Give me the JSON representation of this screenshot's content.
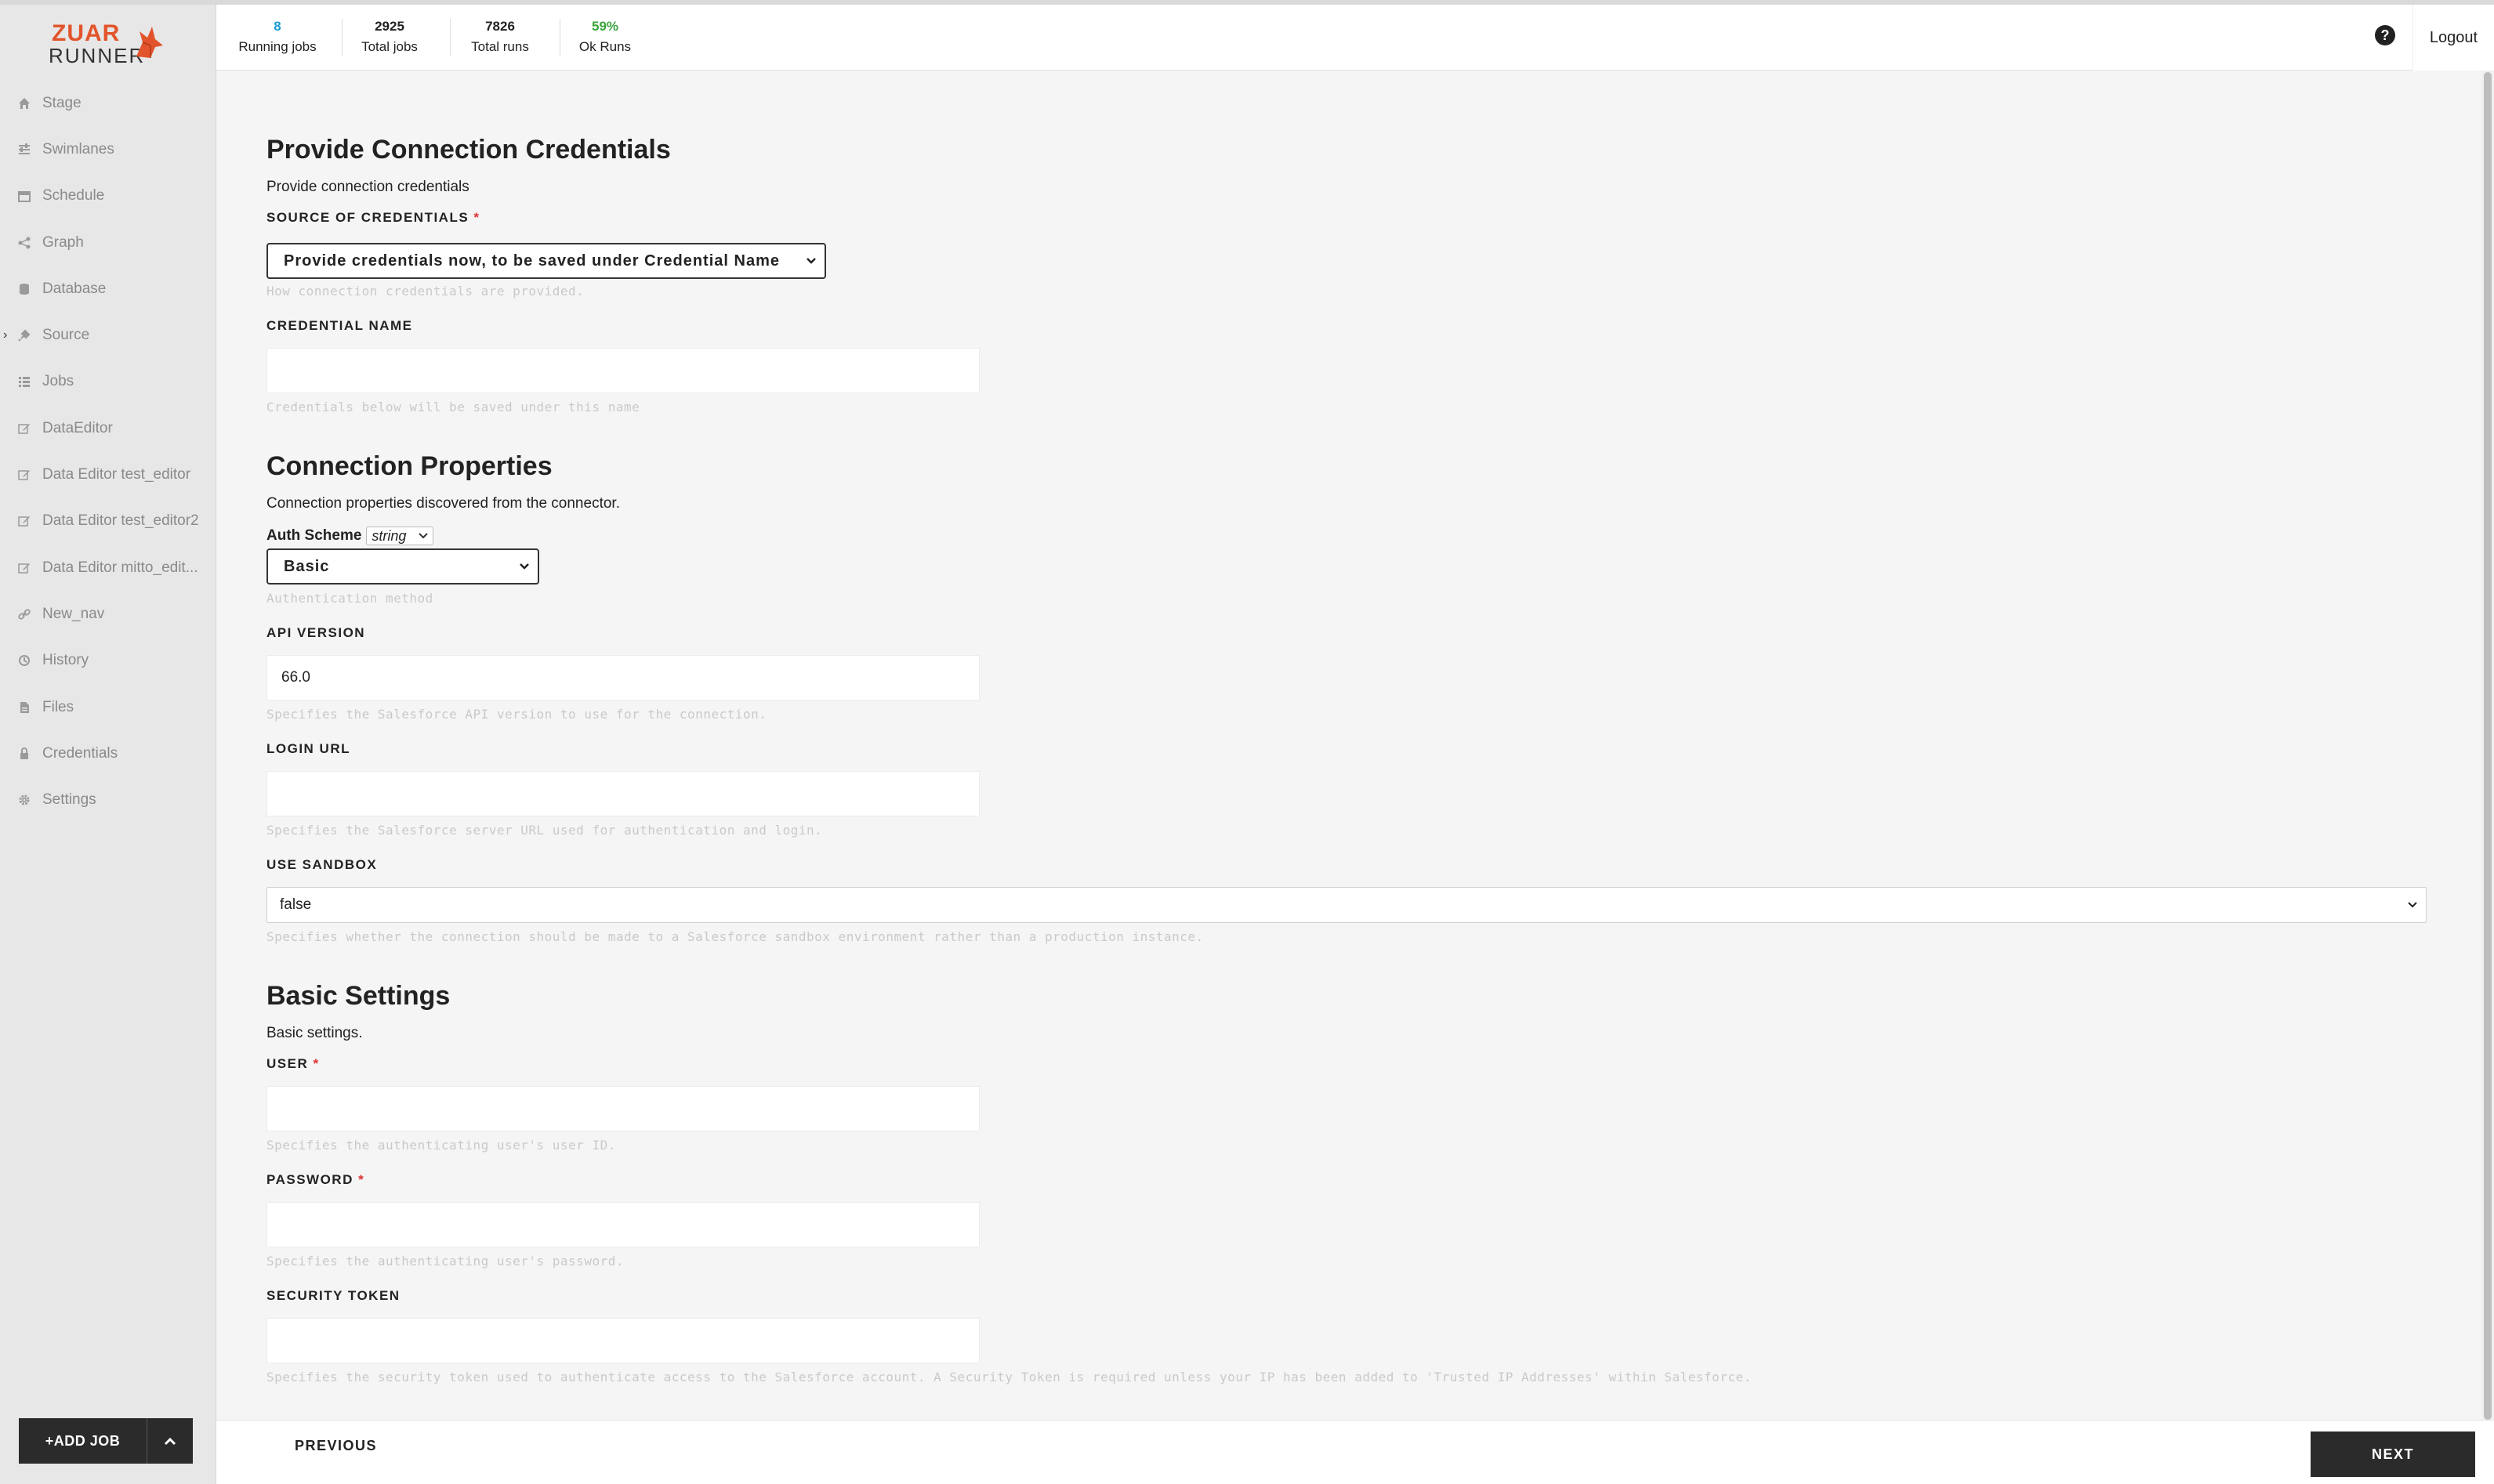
{
  "app": {
    "logo_top": "ZUAR",
    "logo_bottom": "RUNNER"
  },
  "header": {
    "stats": [
      {
        "value": "8",
        "label": "Running jobs",
        "color": "#1a9ad6"
      },
      {
        "value": "2925",
        "label": "Total jobs",
        "color": "#222222"
      },
      {
        "value": "7826",
        "label": "Total runs",
        "color": "#222222"
      },
      {
        "value": "59%",
        "label": "Ok Runs",
        "color": "#3aa53a"
      }
    ],
    "help_glyph": "?",
    "logout": "Logout"
  },
  "sidebar": {
    "items": [
      {
        "label": "Stage",
        "icon": "home-icon"
      },
      {
        "label": "Swimlanes",
        "icon": "sliders-icon"
      },
      {
        "label": "Schedule",
        "icon": "calendar-icon"
      },
      {
        "label": "Graph",
        "icon": "share-icon"
      },
      {
        "label": "Database",
        "icon": "database-icon"
      },
      {
        "label": "Source",
        "icon": "plug-icon",
        "expanded_caret": "›"
      },
      {
        "label": "Jobs",
        "icon": "list-icon"
      },
      {
        "label": "DataEditor",
        "icon": "edit-icon"
      },
      {
        "label": "Data Editor test_editor",
        "icon": "edit-icon"
      },
      {
        "label": "Data Editor test_editor2",
        "icon": "edit-icon"
      },
      {
        "label": "Data Editor mitto_edit...",
        "icon": "edit-icon"
      },
      {
        "label": "New_nav",
        "icon": "link-icon"
      },
      {
        "label": "History",
        "icon": "history-icon"
      },
      {
        "label": "Files",
        "icon": "file-icon"
      },
      {
        "label": "Credentials",
        "icon": "lock-icon"
      },
      {
        "label": "Settings",
        "icon": "gear-icon"
      }
    ],
    "add_job": "+ADD JOB"
  },
  "form": {
    "credentials": {
      "title": "Provide Connection Credentials",
      "description": "Provide connection credentials",
      "source_label": "SOURCE OF CREDENTIALS",
      "source_value": "Provide credentials now, to be saved under Credential Name",
      "source_hint": "How connection credentials are provided.",
      "name_label": "CREDENTIAL NAME",
      "name_value": "",
      "name_hint": "Credentials below will be saved under this name"
    },
    "connection": {
      "title": "Connection Properties",
      "description": "Connection properties discovered from the connector.",
      "auth_label": "Auth Scheme",
      "auth_type": "string",
      "auth_value": "Basic",
      "auth_hint": "Authentication method",
      "api_label": "API VERSION",
      "api_value": "66.0",
      "api_hint": "Specifies the Salesforce API version to use for the connection.",
      "login_label": "LOGIN URL",
      "login_value": "",
      "login_hint": "Specifies the Salesforce server URL used for authentication and login.",
      "sandbox_label": "USE SANDBOX",
      "sandbox_value": "false",
      "sandbox_hint": "Specifies whether the connection should be made to a Salesforce sandbox environment rather than a production instance."
    },
    "basic": {
      "title": "Basic Settings",
      "description": "Basic settings.",
      "user_label": "USER",
      "user_value": "",
      "user_hint": "Specifies the authenticating user's user ID.",
      "password_label": "PASSWORD",
      "password_value": "",
      "password_hint": "Specifies the authenticating user's password.",
      "token_label": "SECURITY TOKEN",
      "token_value": "",
      "token_hint": "Specifies the security token used to authenticate access to the Salesforce account. A Security Token is required unless your IP has been added to 'Trusted IP Addresses' within Salesforce."
    },
    "required_mark": "*"
  },
  "footer": {
    "previous": "PREVIOUS",
    "next": "NEXT"
  }
}
